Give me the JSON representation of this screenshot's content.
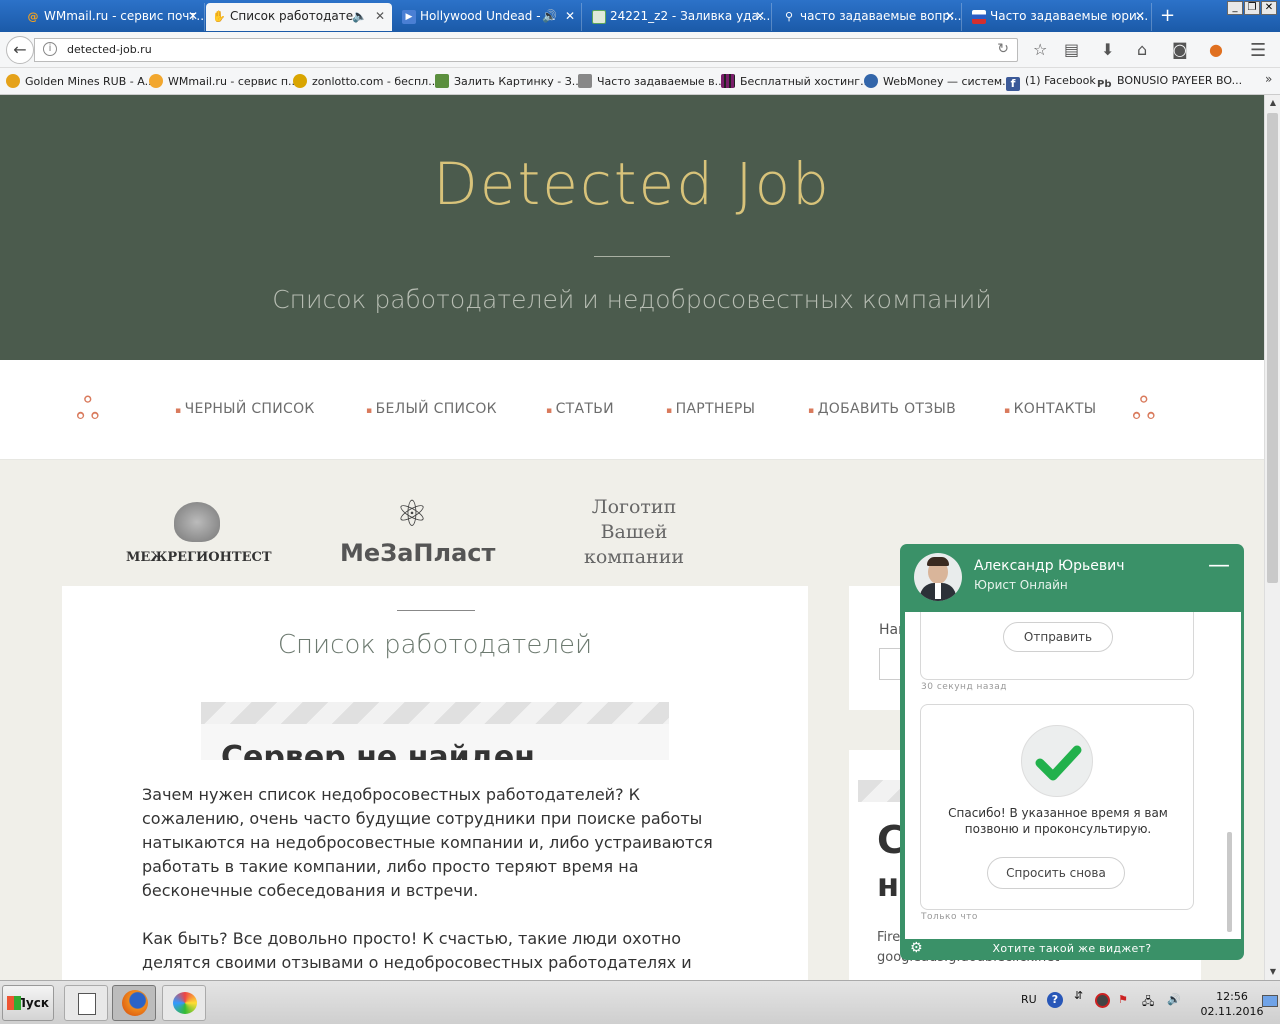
{
  "browser": {
    "tabs": [
      {
        "label": "WMmail.ru - сервис почт...",
        "icon": "at-icon",
        "color": "#f0a020"
      },
      {
        "label": "Список работодате...",
        "icon": "hand-icon",
        "color": "#333",
        "active": true
      },
      {
        "label": "Hollywood Undead - ...",
        "icon": "video-icon",
        "color": "#4a7fd4"
      },
      {
        "label": "24221_z2 - Заливка уда...",
        "icon": "image-icon",
        "color": "#5ba55b"
      },
      {
        "label": "часто задаваемые вопр...",
        "icon": "search-icon",
        "color": "#fff"
      },
      {
        "label": "Часто задаваемые юри...",
        "icon": "flag-icon",
        "color": "#d32f2f"
      }
    ],
    "new_tab": "+",
    "url": "detected-job.ru",
    "bookmarks": [
      {
        "label": "Golden Mines RUB - A...",
        "color": "#e5a21a"
      },
      {
        "label": "WMmail.ru - сервис п...",
        "color": "#f2a72e"
      },
      {
        "label": "zonlotto.com - беспл...",
        "color": "#d9a500"
      },
      {
        "label": "Залить Картинку - З...",
        "color": "#5b8f3e"
      },
      {
        "label": "Часто задаваемые в...",
        "color": "#888"
      },
      {
        "label": "Бесплатный хостинг...",
        "color": "#7a1e6b"
      },
      {
        "label": "WebMoney — систем...",
        "color": "#3366aa"
      },
      {
        "label": "(1) Facebook",
        "color": "#3b5998"
      },
      {
        "label": "BONUSIO PAYEER BO...",
        "color": "#444"
      }
    ]
  },
  "site": {
    "title": "Detected Job",
    "subtitle": "Список работодателей и недобросовестных компаний",
    "menu": [
      "ЧЕРНЫЙ СПИСОК",
      "БЕЛЫЙ СПИСОК",
      "СТАТЬИ",
      "ПАРТНЕРЫ",
      "ДОБАВИТЬ ОТЗЫВ",
      "КОНТАКТЫ"
    ],
    "logos": {
      "l1": "МЕЖРЕГИОНТЕСТ",
      "l2": "МеЗаПласт",
      "l3": "Логотип\nВашей\nкомпании"
    },
    "list_title": "Список работодателей",
    "error_heading": "Сервер не найден",
    "para1": "Зачем нужен список недобросовестных работодателей? К сожалению, очень часто будущие сотрудники при поиске работы натыкаются на недобросовестные компании и, либо устраиваются работать в такие компании, либо просто теряют время на бесконечные собеседования и встречи.",
    "para2": "Как быть? Все довольно просто! К счастью, такие люди охотно делятся своими отзывами о недобросовестных работодателях и предостерегают",
    "search_label": "Най",
    "side_big1": "С",
    "side_big2": "н",
    "side_small": "Fire\ngoogleads.g.doubleclick.net"
  },
  "chat": {
    "name": "Александр Юрьевич",
    "role": "Юрист Онлайн",
    "send": "Отправить",
    "ts1": "30 секунд назад",
    "thanks": "Спасибо! В указанное время я вам позвоню и проконсультирую.",
    "ask_again": "Спросить снова",
    "ts2": "Только что",
    "promo": "Хотите такой же виджет?",
    "accent": "#3a9168"
  },
  "taskbar": {
    "start": "Пуск",
    "lang": "RU",
    "time": "12:56",
    "date": "02.11.2016"
  }
}
